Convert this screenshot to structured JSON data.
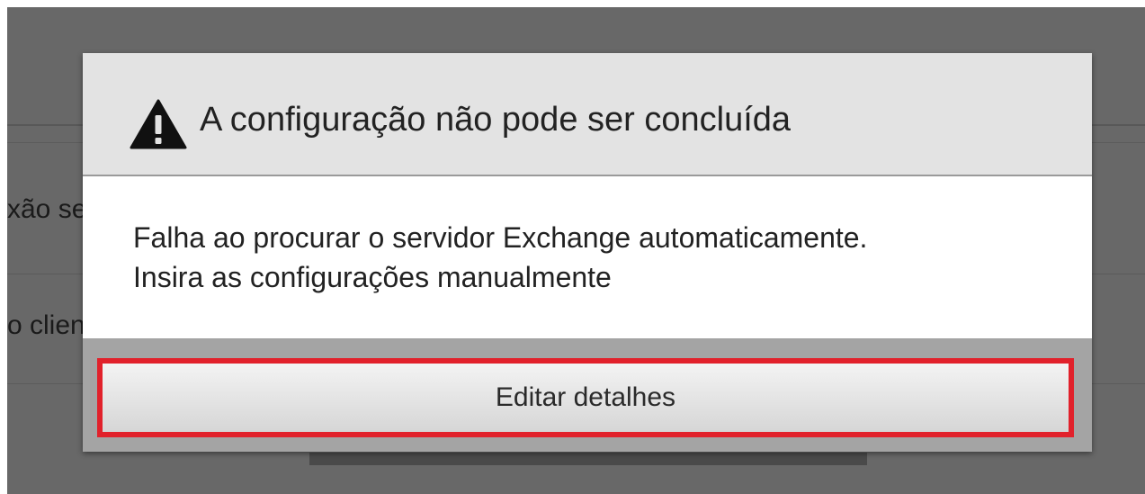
{
  "background": {
    "row_1_text": "xão se",
    "row_2_text": "o clien"
  },
  "dialog": {
    "icon": "warning-icon",
    "title": "A configuração não pode ser concluída",
    "message_line_1": "Falha ao procurar o servidor Exchange automaticamente.",
    "message_line_2": "Insira as configurações manualmente",
    "button_label": "Editar detalhes"
  },
  "colors": {
    "overlay": "#686868",
    "header_bg": "#e3e3e3",
    "button_area_bg": "#a4a4a4",
    "highlight_border": "#e1212b"
  }
}
